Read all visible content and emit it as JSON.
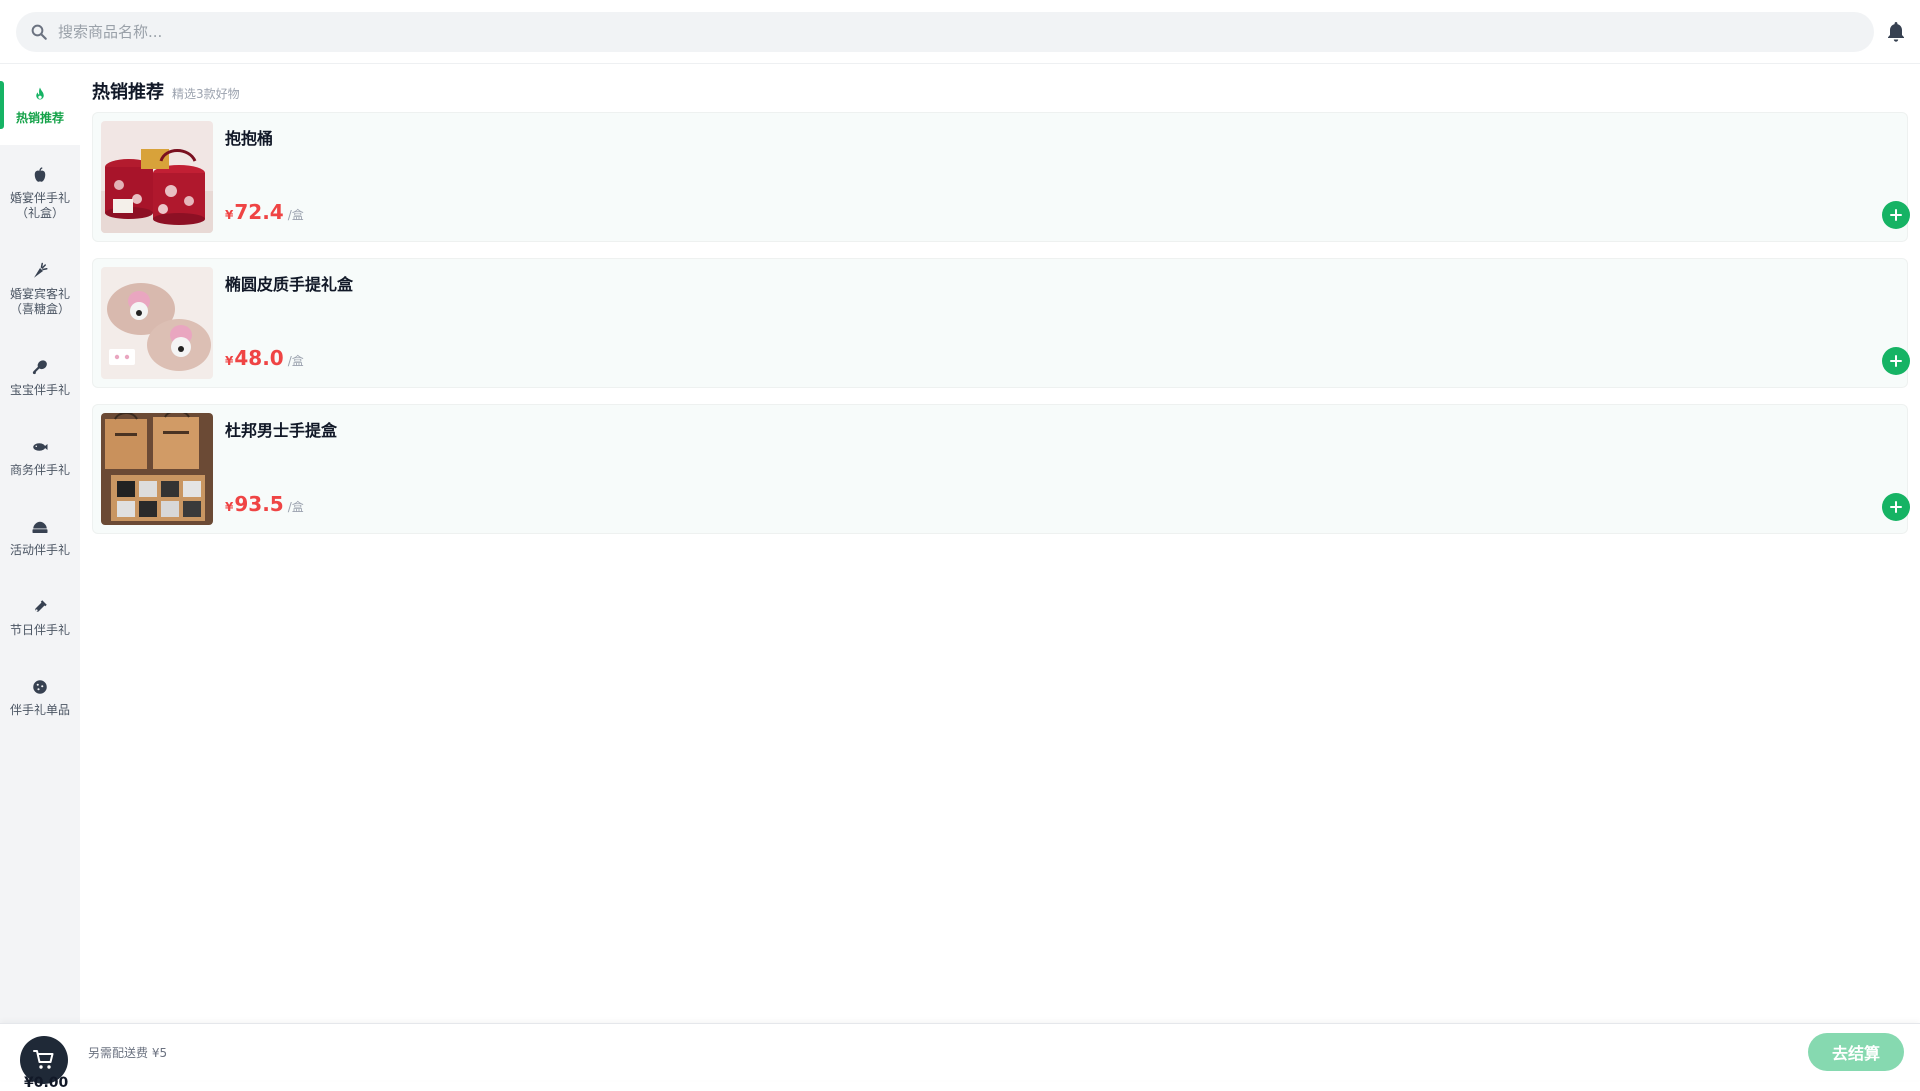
{
  "search": {
    "placeholder": "搜索商品名称..."
  },
  "colors": {
    "accent": "#16b364",
    "price": "#ef4444",
    "sidebar_bg": "#f3f4f6",
    "card_bg": "#f7fbfa",
    "checkout_disabled": "#86d9b0"
  },
  "sidebar": {
    "items": [
      {
        "label": "热销推荐",
        "icon": "fire-icon",
        "active": true
      },
      {
        "label": "婚宴伴手礼\n（礼盒）",
        "icon": "apple-icon",
        "active": false
      },
      {
        "label": "婚宴宾客礼\n（喜糖盒）",
        "icon": "carrot-icon",
        "active": false
      },
      {
        "label": "宝宝伴手礼",
        "icon": "drumstick-icon",
        "active": false
      },
      {
        "label": "商务伴手礼",
        "icon": "fish-icon",
        "active": false
      },
      {
        "label": "活动伴手礼",
        "icon": "cake-icon",
        "active": false
      },
      {
        "label": "节日伴手礼",
        "icon": "bottle-icon",
        "active": false
      },
      {
        "label": "伴手礼单品",
        "icon": "cookie-icon",
        "active": false
      }
    ]
  },
  "section": {
    "title": "热销推荐",
    "subtitle": "精选3款好物"
  },
  "products": [
    {
      "name": "抱抱桶",
      "currency": "¥",
      "price": "72.4",
      "unit": "/盒",
      "image": "red-floral-gift-buckets"
    },
    {
      "name": "椭圆皮质手提礼盒",
      "currency": "¥",
      "price": "48.0",
      "unit": "/盒",
      "image": "pink-oval-leather-boxes"
    },
    {
      "name": "杜邦男士手提盒",
      "currency": "¥",
      "price": "93.5",
      "unit": "/盒",
      "image": "kraft-paper-gift-boxes"
    }
  ],
  "cart": {
    "total": "¥0.00",
    "delivery_note": "另需配送费 ¥5",
    "checkout_label": "去结算"
  }
}
